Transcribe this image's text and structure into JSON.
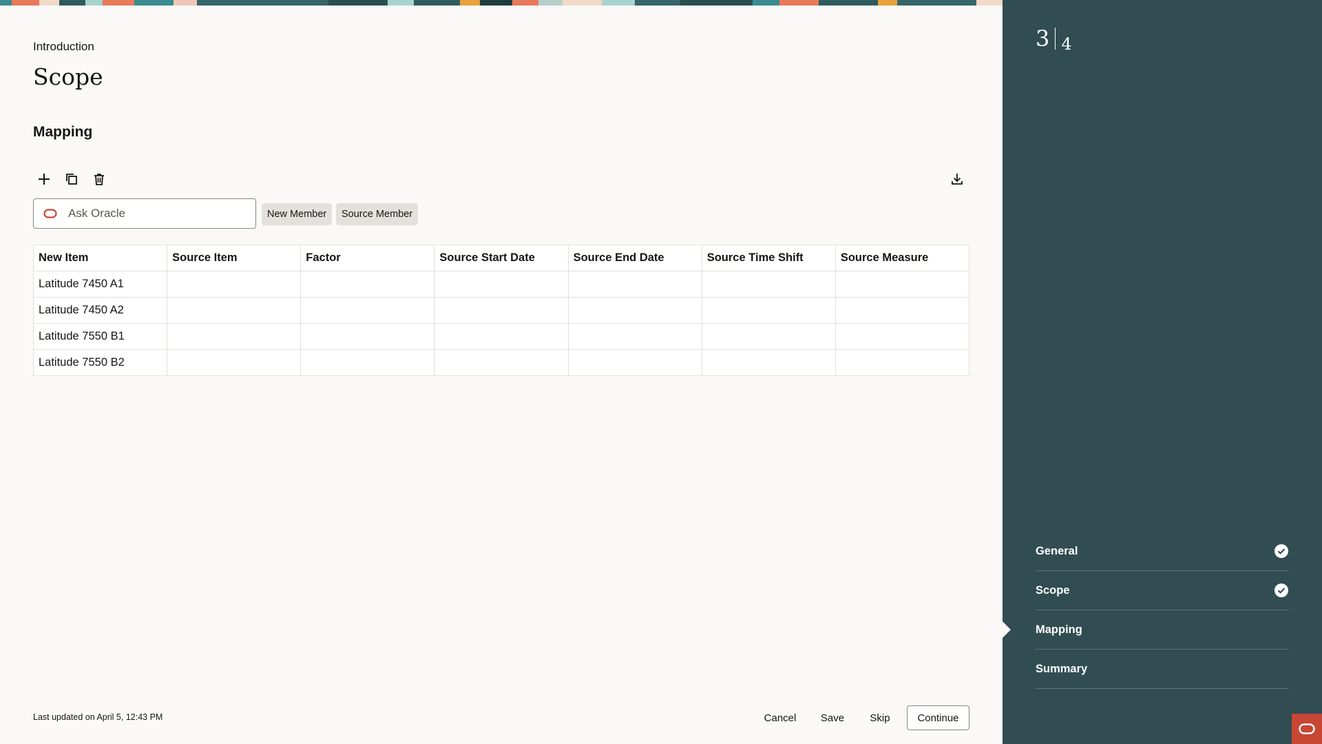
{
  "header": {
    "breadcrumb": "Introduction",
    "title": "Scope",
    "section_title": "Mapping"
  },
  "toolbar": {
    "add_icon": "plus-icon",
    "duplicate_icon": "copy-icon",
    "delete_icon": "trash-icon",
    "download_icon": "download-icon"
  },
  "search": {
    "placeholder": "Ask Oracle",
    "icon": "oracle-ring-icon"
  },
  "chips": [
    "New Member",
    "Source Member"
  ],
  "table": {
    "columns": [
      "New Item",
      "Source Item",
      "Factor",
      "Source Start Date",
      "Source End Date",
      "Source Time Shift",
      "Source Measure"
    ],
    "rows": [
      [
        "Latitude 7450 A1",
        "",
        "",
        "",
        "",
        "",
        ""
      ],
      [
        "Latitude 7450 A2",
        "",
        "",
        "",
        "",
        "",
        ""
      ],
      [
        "Latitude 7550 B1",
        "",
        "",
        "",
        "",
        "",
        ""
      ],
      [
        "Latitude 7550 B2",
        "",
        "",
        "",
        "",
        "",
        ""
      ]
    ]
  },
  "footer": {
    "last_updated": "Last updated on April 5, 12:43 PM",
    "cancel_label": "Cancel",
    "save_label": "Save",
    "skip_label": "Skip",
    "continue_label": "Continue"
  },
  "rail": {
    "step_current": "3",
    "step_total": "4",
    "steps": [
      {
        "label": "General",
        "completed": true
      },
      {
        "label": "Scope",
        "completed": true
      },
      {
        "label": "Mapping",
        "completed": false,
        "active": true
      },
      {
        "label": "Summary",
        "completed": false
      }
    ],
    "background": "#314d52",
    "badge_color": "#c74634"
  }
}
